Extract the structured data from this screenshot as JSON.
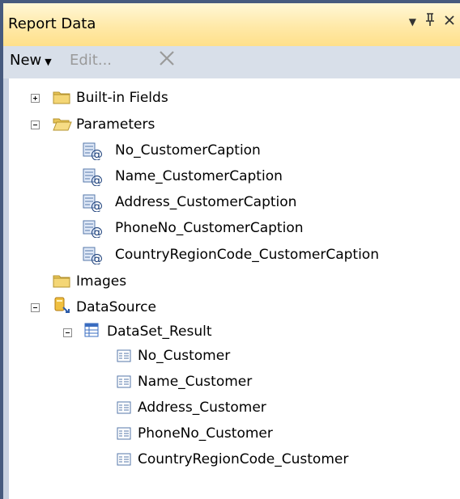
{
  "window": {
    "title": "Report Data",
    "controls": {
      "dropdown": "▼",
      "pin": "ꟷ",
      "close": "×"
    }
  },
  "toolbar": {
    "new_label": "New",
    "edit_label": "Edit...",
    "delete_label": "✕"
  },
  "tree": {
    "builtin_fields": "Built-in Fields",
    "parameters": {
      "label": "Parameters",
      "items": [
        "No_CustomerCaption",
        "Name_CustomerCaption",
        "Address_CustomerCaption",
        "PhoneNo_CustomerCaption",
        "CountryRegionCode_CustomerCaption"
      ]
    },
    "images": "Images",
    "datasource": {
      "label": "DataSource",
      "dataset": {
        "label": "DataSet_Result",
        "fields": [
          "No_Customer",
          "Name_Customer",
          "Address_Customer",
          "PhoneNo_Customer",
          "CountryRegionCode_Customer"
        ]
      }
    }
  },
  "icons": {
    "folder-closed": "folder-icon",
    "folder-open": "folder-open-icon",
    "parameter": "parameter-icon",
    "datasource": "datasource-icon",
    "dataset": "dataset-icon",
    "field": "field-icon"
  },
  "colors": {
    "border": "#465a7e",
    "title_bg": "#ffe9a8",
    "toolbar_bg": "#d8dfe9",
    "folder": "#e8c457"
  }
}
